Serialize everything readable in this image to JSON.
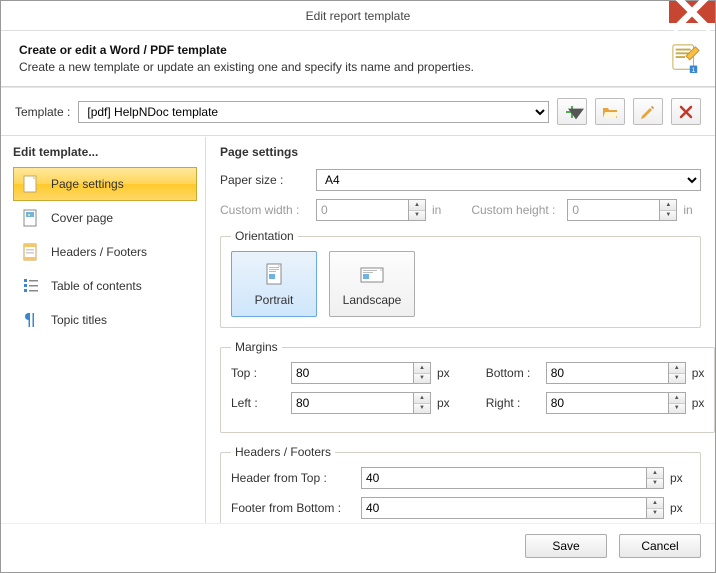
{
  "window": {
    "title": "Edit report template"
  },
  "header": {
    "title": "Create or edit a Word / PDF template",
    "subtitle": "Create a new template or update an existing one and specify its name and properties."
  },
  "template": {
    "label": "Template :",
    "value": "[pdf] HelpNDoc template"
  },
  "sidebar": {
    "title": "Edit template...",
    "items": [
      {
        "label": "Page settings",
        "selected": true
      },
      {
        "label": "Cover page",
        "selected": false
      },
      {
        "label": "Headers / Footers",
        "selected": false
      },
      {
        "label": "Table of contents",
        "selected": false
      },
      {
        "label": "Topic titles",
        "selected": false
      }
    ]
  },
  "main": {
    "title": "Page settings",
    "paper_size": {
      "label": "Paper size :",
      "value": "A4"
    },
    "custom_width": {
      "label": "Custom width :",
      "value": "0",
      "unit": "in"
    },
    "custom_height": {
      "label": "Custom height :",
      "value": "0",
      "unit": "in"
    },
    "orientation": {
      "legend": "Orientation",
      "portrait": "Portrait",
      "landscape": "Landscape",
      "selected": "portrait"
    },
    "margins": {
      "legend": "Margins",
      "top": {
        "label": "Top :",
        "value": "80",
        "unit": "px"
      },
      "bottom": {
        "label": "Bottom :",
        "value": "80",
        "unit": "px"
      },
      "left": {
        "label": "Left :",
        "value": "80",
        "unit": "px"
      },
      "right": {
        "label": "Right :",
        "value": "80",
        "unit": "px"
      }
    },
    "hf": {
      "legend": "Headers / Footers",
      "header_from_top": {
        "label": "Header from Top :",
        "value": "40",
        "unit": "px"
      },
      "footer_from_bottom": {
        "label": "Footer from Bottom :",
        "value": "40",
        "unit": "px"
      }
    }
  },
  "footer": {
    "save": "Save",
    "cancel": "Cancel"
  }
}
